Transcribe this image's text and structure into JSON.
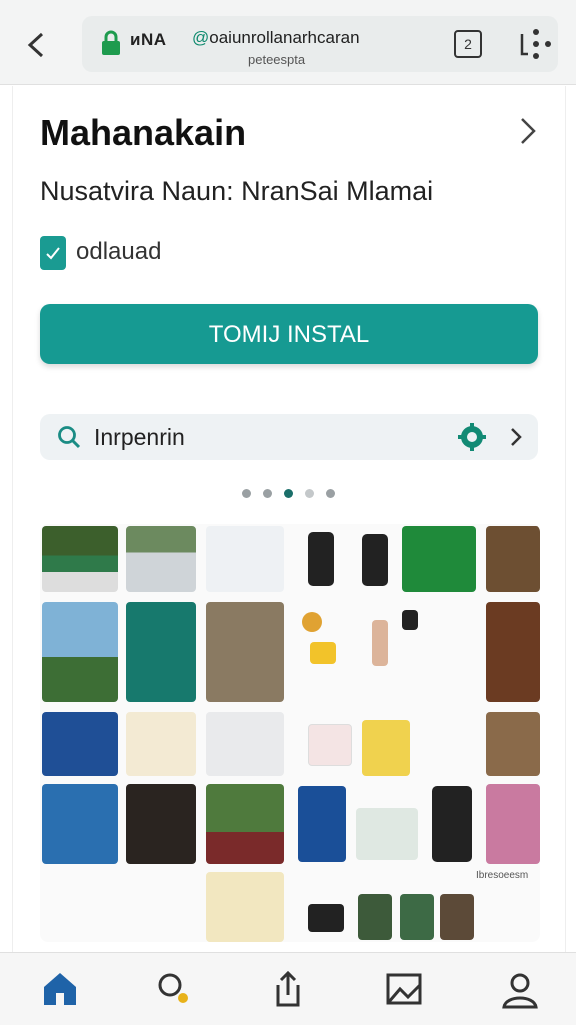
{
  "browser": {
    "site_label": "иNA",
    "url_prefix": "@",
    "url_main": "oaiunrollanarhcaran",
    "url_sub": "peteespta",
    "tabs_count": "2"
  },
  "app": {
    "title": "Mahanakain",
    "subtitle": "Nusatvira Naun: NranSai Mlamai",
    "checkbox_label": "odlauad",
    "install_label": "TOMIJ INSTAL"
  },
  "search": {
    "text": "Inrpenrin"
  },
  "carousel": {
    "page_count": 5,
    "active_index": 2
  },
  "colors": {
    "accent": "#169a92",
    "url_green": "#0f8a6e",
    "home_active": "#1f63a8",
    "search_dot": "#e8b21a"
  },
  "gallery_caption": "Ibresoeesm"
}
